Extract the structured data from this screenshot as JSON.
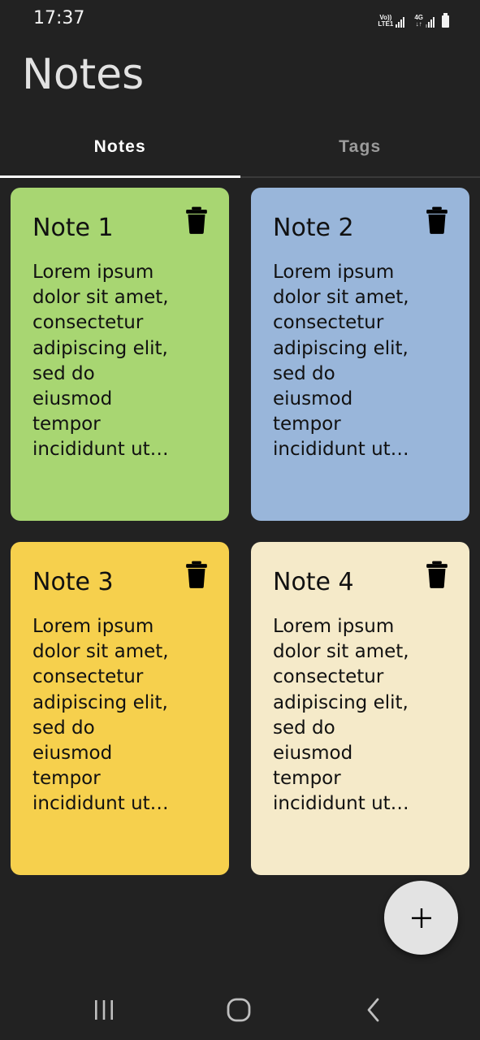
{
  "status_bar": {
    "time": "17:37",
    "network_label_1": "Vo))",
    "network_label_2": "LTE1",
    "network_label_3": "4G",
    "network_label_4": "↓↑"
  },
  "app": {
    "title": "Notes"
  },
  "tabs": [
    {
      "label": "Notes",
      "active": true
    },
    {
      "label": "Tags",
      "active": false
    }
  ],
  "notes": [
    {
      "title": "Note 1",
      "body": "Lorem ipsum dolor sit amet, consectetur adipiscing elit, sed do eiusmod tempor incididunt ut…",
      "color": "#a8d672"
    },
    {
      "title": "Note 2",
      "body": "Lorem ipsum dolor sit amet, consectetur adipiscing elit, sed do eiusmod tempor incididunt ut…",
      "color": "#99b6da"
    },
    {
      "title": "Note 3",
      "body": "Lorem ipsum dolor sit amet, consectetur adipiscing elit, sed do eiusmod tempor incididunt ut…",
      "color": "#f6d04d"
    },
    {
      "title": "Note 4",
      "body": "Lorem ipsum dolor sit amet, consectetur adipiscing elit, sed do eiusmod tempor incididunt ut…",
      "color": "#f5eac9"
    }
  ],
  "icons": {
    "delete": "trash-icon",
    "add": "plus-icon",
    "nav_recents": "recents-icon",
    "nav_home": "home-icon",
    "nav_back": "back-icon"
  },
  "colors": {
    "background": "#222222",
    "tab_active": "#ffffff",
    "tab_inactive": "#9b9b9b",
    "fab": "#e3e3e3"
  }
}
